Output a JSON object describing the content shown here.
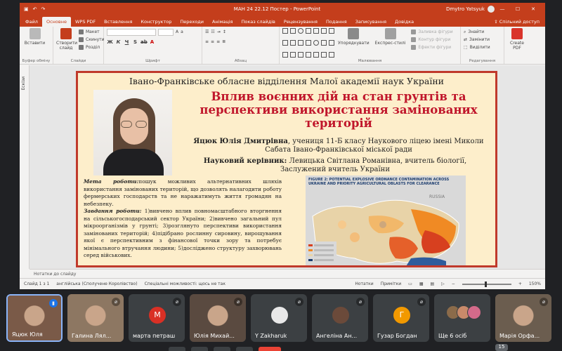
{
  "window": {
    "title": "МАН 24 22.12 Постер  -  PowerPoint",
    "user": "Dmytro Yatsyuk",
    "share_label": "Спільний доступ"
  },
  "tabs": [
    "Файл",
    "Основне",
    "WPS PDF",
    "Вставлення",
    "Конструктор",
    "Переходи",
    "Анімація",
    "Показ слайдів",
    "Рецензування",
    "Подання",
    "Записування",
    "Довідка"
  ],
  "active_tab": "Основне",
  "ribbon": {
    "clipboard": {
      "paste": "Вставити",
      "label": "Буфер обміну"
    },
    "slides": {
      "new_slide": "Створити слайд",
      "layout": "Макет",
      "reset": "Скинути",
      "section": "Розділ",
      "label": "Слайди"
    },
    "font": {
      "label": "Шрифт"
    },
    "paragraph": {
      "label": "Абзац"
    },
    "drawing": {
      "arrange": "Упорядкувати",
      "quick_styles": "Експрес-стилі",
      "fill": "Заливка фігури",
      "outline": "Контур фігури",
      "effects": "Ефекти фігури",
      "label": "Малювання"
    },
    "editing": {
      "find": "Знайти",
      "replace": "Замінити",
      "select": "Виділити",
      "label": "Редагування"
    },
    "pdf": {
      "create": "Create PDF"
    }
  },
  "sidebar_label": "Ескізи",
  "slide": {
    "header": "Івано-Франківське обласне відділення Малої академії наук України",
    "title": "Вплив воєнних дій на стан грунтів та перспективи використання замінованих територій",
    "author_name": "Яцюк Юлія Дмитрівна",
    "author_rest": ", учениця 11-Б класу Наукового ліцею імені Миколи Сабата Івано-Франківської міської ради",
    "supervisor_label": "Науковий керівник:",
    "supervisor": " Левицька Світлана Романівна, вчитель біології, Заслужений вчитель України",
    "goal_label": "Мета роботи:",
    "goal_text": "пошук можливих альтернативних шляхів використання замінованих територій, що дозволять налагодити роботу фермерських господарств та не наражатимуть життя громадян на небезпеку.",
    "tasks_label": "Завдання роботи:",
    "tasks_text": " 1)вивчено вплив повномасштабного вторгнення на сільськогосподарський сектор України; 2)вивчено загальний пул мікроорганізмів у грунті; 3)розглянуто перспективи використання замінованих територій; 4)підібрано рослинну сировину, вирощування якої є перспективним з фінансової точки зору та потребує мінімального втручання людини; 5)досліджено структуру захворювань серед військових.",
    "map_caption": "FIGURE 2: POTENTIAL EXPLOSIVE ORDNANCE CONTAMINATION ACROSS UKRAINE AND PRIORITY AGRICULTURAL OBLASTS FOR CLEARANCE",
    "map_region_label": "RUSSIA"
  },
  "notes_placeholder": "Нотатки до слайду",
  "status": {
    "slide_info": "Слайд 1 з 1",
    "language": "англійська (Сполучене Королівство)",
    "accessibility": "Спеціальні можливості: щось не так",
    "notes": "Нотатки",
    "comments": "Примітки",
    "zoom": "150%"
  },
  "participants": [
    {
      "name": "Яцюк Юля",
      "type": "video",
      "speaking": true
    },
    {
      "name": "Галина Лял...",
      "type": "video",
      "speaking": false
    },
    {
      "name": "марта петраш",
      "type": "avatar",
      "initial": "М",
      "color": "#d93025",
      "speaking": false
    },
    {
      "name": "Юлія Михай...",
      "type": "video",
      "speaking": false
    },
    {
      "name": "Y Zakharuk",
      "type": "photo",
      "speaking": false
    },
    {
      "name": "Ангеліна Ан...",
      "type": "photo",
      "speaking": false
    },
    {
      "name": "Гузар Богдан",
      "type": "avatar",
      "initial": "Г",
      "color": "#f29900",
      "speaking": false
    },
    {
      "name": "Ще 6 осіб",
      "type": "group",
      "speaking": false
    },
    {
      "name": "Марія Орфа...",
      "type": "video",
      "speaking": false
    }
  ],
  "participant_count": "15"
}
